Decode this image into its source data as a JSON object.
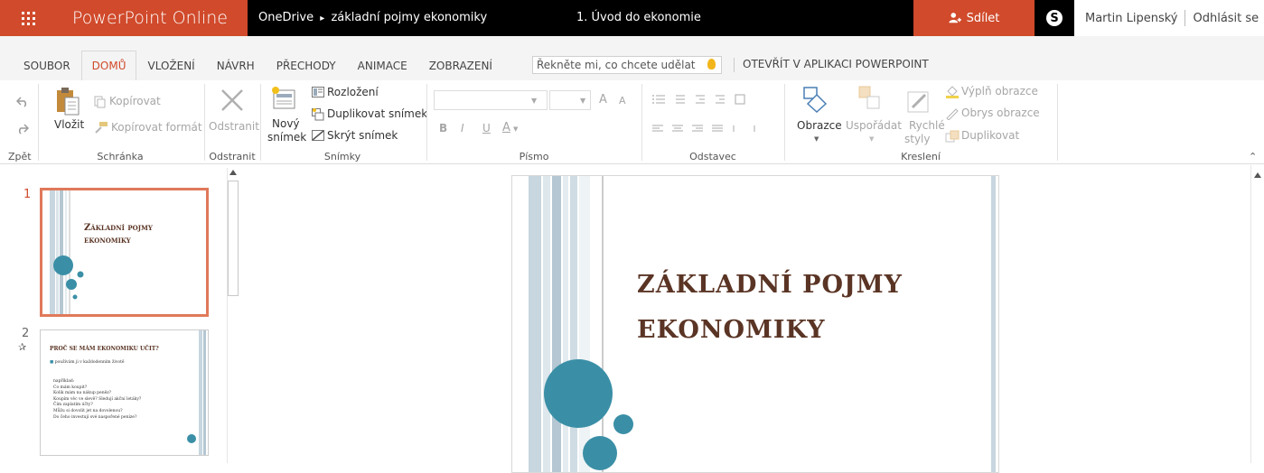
{
  "topbar": {
    "app_name": "PowerPoint Online",
    "breadcrumb_root": "OneDrive",
    "breadcrumb_sep": "▸",
    "breadcrumb_folder": "základní pojmy ekonomiky",
    "doc_title": "1. Úvod do ekonomie",
    "share_label": "Sdílet",
    "user_name": "Martin Lipenský",
    "signout_label": "Odhlásit se",
    "accent_color": "#d04a2b"
  },
  "menu": {
    "tabs": [
      "SOUBOR",
      "DOMŮ",
      "VLOŽENÍ",
      "NÁVRH",
      "PŘECHODY",
      "ANIMACE",
      "ZOBRAZENÍ"
    ],
    "active_tab": "DOMŮ",
    "tell_me_placeholder": "Řekněte mi, co chcete udělat",
    "open_in_app": "OTEVŘÍT V APLIKACI POWERPOINT"
  },
  "ribbon": {
    "undo": {
      "group_label": "Zpět"
    },
    "clipboard": {
      "paste": "Vložit",
      "copy": "Kopírovat",
      "format_painter": "Kopírovat formát",
      "group_label": "Schránka"
    },
    "delete": {
      "label": "Odstranit",
      "group_label": "Odstranit"
    },
    "slides": {
      "new_slide_1": "Nový",
      "new_slide_2": "snímek",
      "layout": "Rozložení",
      "duplicate": "Duplikovat snímek",
      "hide": "Skrýt snímek",
      "group_label": "Snímky"
    },
    "font": {
      "bold": "B",
      "italic": "I",
      "underline": "U",
      "font_color": "A",
      "grow": "A",
      "shrink": "A",
      "group_label": "Písmo"
    },
    "paragraph": {
      "group_label": "Odstavec"
    },
    "drawing": {
      "shapes": "Obrazce",
      "arrange": "Uspořádat",
      "quick_styles_1": "Rychlé",
      "quick_styles_2": "styly",
      "fill": "Výplň obrazce",
      "outline": "Obrys obrazce",
      "duplicate": "Duplikovat",
      "group_label": "Kreslení"
    }
  },
  "thumbnails": [
    {
      "number": "1",
      "title_line1": "Základní pojmy",
      "title_line2": "ekonomiky"
    },
    {
      "number": "2",
      "title": "PROČ SE MÁM EKONOMIKU UČIT?",
      "bullet": "používám ji v každodenním životě",
      "lines": [
        "například:",
        "Co mám koupit?",
        "Kolik mám na nákup peněz?",
        "Koupím věc ve slevě? Sledují akční letáky?",
        "Čím zaplatím účty?",
        "Můžu si dovolit jet na dovolenou?",
        "Do čeho investují své naspořené peníze?"
      ]
    }
  ],
  "slide": {
    "title_line1": "ZÁKLADNÍ POJMY",
    "title_line2": "EKONOMIKY",
    "circle_color": "#3a8fa6",
    "title_color": "#5a3424"
  }
}
